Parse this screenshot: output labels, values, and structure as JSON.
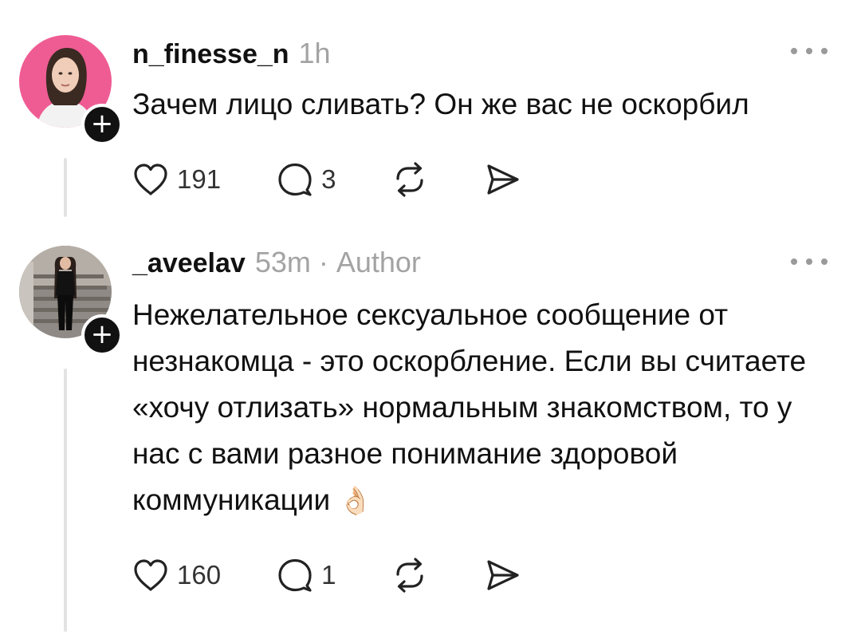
{
  "comments": [
    {
      "username": "n_finesse_n",
      "time": "1h",
      "text": "Зачем лицо сливать? Он же вас не оскорбил",
      "likes": "191",
      "replies": "3"
    },
    {
      "username": "_aveelav",
      "time": "53m",
      "author_sep": "·",
      "author_label": "Author",
      "text": "Нежелательное сексуальное сообщение от незнакомца - это оскорбление. Если вы считаете «хочу отлизать» нормальным знакомством, то у нас с вами разное понимание здоровой коммуникации",
      "emoji": "👌🏻",
      "likes": "160",
      "replies": "1"
    }
  ],
  "follow_symbol": "+",
  "icons": {
    "like": "heart-icon",
    "reply": "comment-icon",
    "repost": "repost-icon",
    "share": "send-icon",
    "more": "more-icon"
  },
  "colors": {
    "text": "#111111",
    "muted": "#a3a3a3",
    "avatar1_bg": "#ef5c93",
    "badge": "#111111"
  }
}
